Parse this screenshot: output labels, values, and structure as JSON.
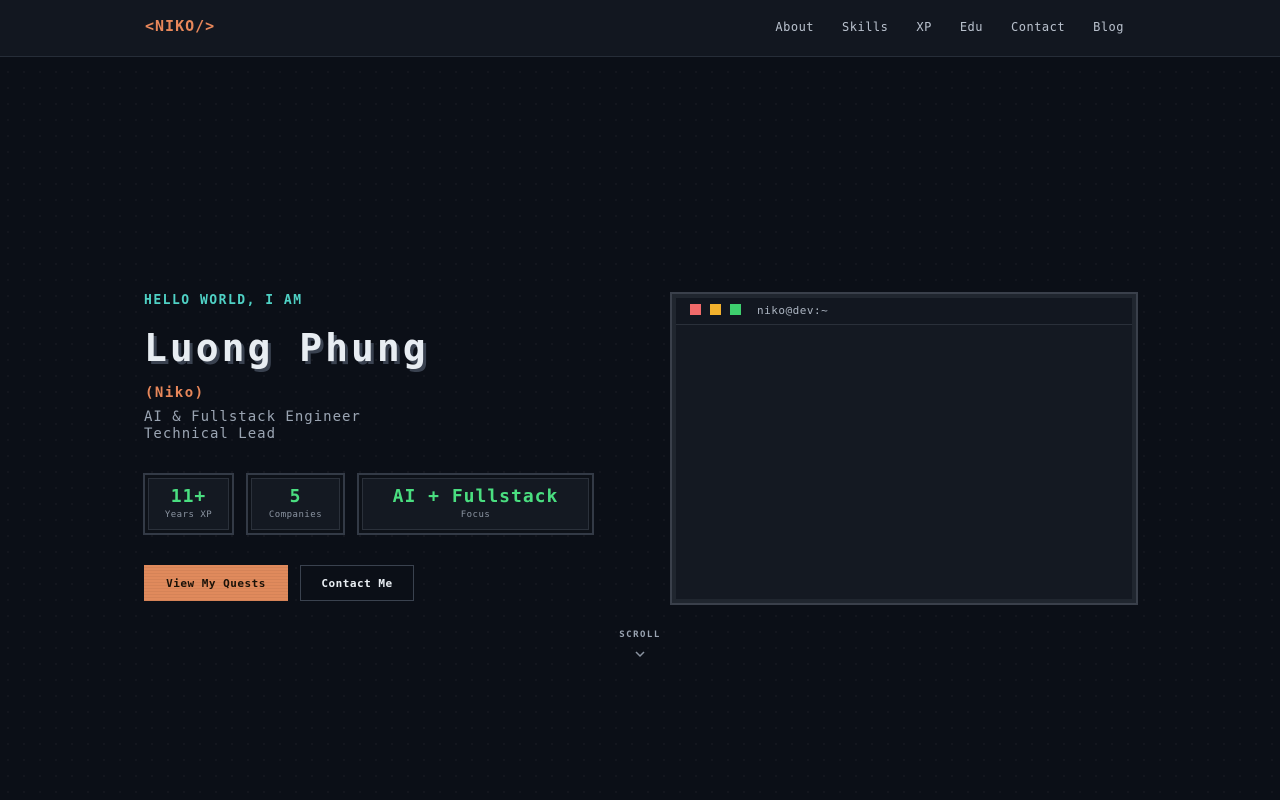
{
  "nav": {
    "logo": "<NIKO/>",
    "links": [
      "About",
      "Skills",
      "XP",
      "Edu",
      "Contact",
      "Blog"
    ]
  },
  "hero": {
    "greeting": "HELLO WORLD, I AM",
    "name": "Luong Phung",
    "nickname": "(Niko)",
    "roles": [
      "AI & Fullstack Engineer",
      "Technical Lead"
    ],
    "stats": [
      {
        "value": "11+",
        "label": "Years XP"
      },
      {
        "value": "5",
        "label": "Companies"
      },
      {
        "value": "AI + Fullstack",
        "label": "Focus"
      }
    ],
    "primary_button": "View My Quests",
    "secondary_button": "Contact Me"
  },
  "terminal": {
    "title": "niko@dev:~"
  },
  "scroll": {
    "label": "SCROLL",
    "icon": "chevron-down-icon"
  },
  "colors": {
    "accent_orange": "#e8875a",
    "accent_teal": "#4fd1c5",
    "accent_green": "#4ade80",
    "background": "#0b0f17"
  }
}
